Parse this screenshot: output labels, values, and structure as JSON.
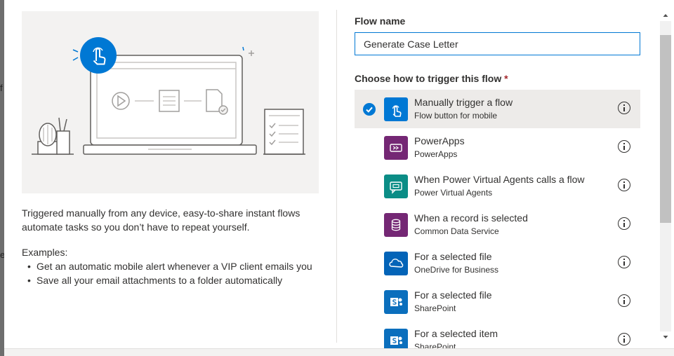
{
  "background": {
    "edge_glyph_1": "f",
    "edge_glyph_2": "e"
  },
  "left": {
    "description": "Triggered manually from any device, easy-to-share instant flows automate tasks so you don’t have to repeat yourself.",
    "examples_label": "Examples:",
    "examples": [
      "Get an automatic mobile alert whenever a VIP client emails you",
      "Save all your email attachments to a folder automatically"
    ]
  },
  "flow_name": {
    "label": "Flow name",
    "value": "Generate Case Letter"
  },
  "trigger": {
    "label": "Choose how to trigger this flow",
    "required_marker": "*",
    "items": [
      {
        "title": "Manually trigger a flow",
        "subtitle": "Flow button for mobile",
        "icon": "touch-icon",
        "color": "#0078d4",
        "selected": true
      },
      {
        "title": "PowerApps",
        "subtitle": "PowerApps",
        "icon": "powerapps-icon",
        "color": "#742774",
        "selected": false
      },
      {
        "title": "When Power Virtual Agents calls a flow",
        "subtitle": "Power Virtual Agents",
        "icon": "chat-bot-icon",
        "color": "#0b8d86",
        "selected": false
      },
      {
        "title": "When a record is selected",
        "subtitle": "Common Data Service",
        "icon": "database-icon",
        "color": "#742774",
        "selected": false
      },
      {
        "title": "For a selected file",
        "subtitle": "OneDrive for Business",
        "icon": "onedrive-icon",
        "color": "#0364b8",
        "selected": false
      },
      {
        "title": "For a selected file",
        "subtitle": "SharePoint",
        "icon": "sharepoint-icon",
        "color": "#0b6fbd",
        "selected": false
      },
      {
        "title": "For a selected item",
        "subtitle": "SharePoint",
        "icon": "sharepoint-icon",
        "color": "#0b6fbd",
        "selected": false
      }
    ]
  },
  "colors": {
    "accent": "#0078d4",
    "selected_row": "#edebe9"
  }
}
